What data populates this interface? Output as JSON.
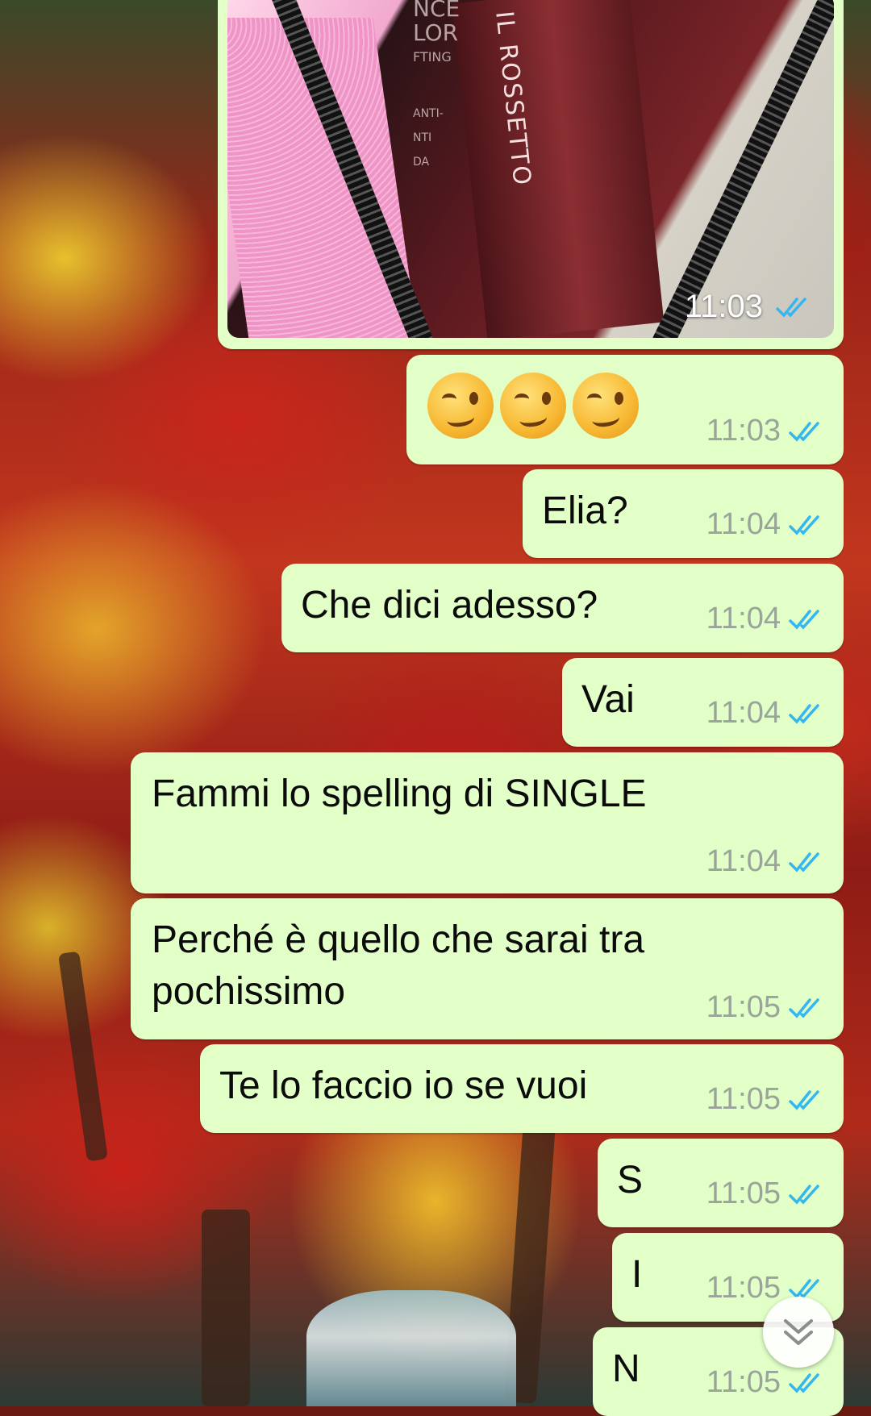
{
  "conversation": {
    "image_message": {
      "time": "11:03",
      "photo_text": {
        "brand_lines": [
          "NCE",
          "LOR",
          "FTING",
          "ANTI-",
          "NTI",
          "DA"
        ],
        "product": "IL ROSSETTO"
      }
    },
    "messages": [
      {
        "text": "",
        "emoji": [
          "winking-face",
          "winking-face",
          "winking-face"
        ],
        "time": "11:03"
      },
      {
        "text": "Elia?",
        "time": "11:04"
      },
      {
        "text": "Che dici adesso?",
        "time": "11:04"
      },
      {
        "text": "Vai",
        "time": "11:04"
      },
      {
        "text": "Fammi lo spelling di SINGLE",
        "time": "11:04"
      },
      {
        "text": "Perché è quello che sarai tra",
        "text_line2": "pochissimo",
        "time": "11:05"
      },
      {
        "text": "Te lo faccio io se vuoi",
        "time": "11:05"
      },
      {
        "text": "S",
        "time": "11:05"
      },
      {
        "text": "I",
        "time": "11:05"
      },
      {
        "text": "N",
        "time": "11:05"
      }
    ]
  },
  "status": {
    "read_icon": "double-check-icon",
    "read_color": "#34b7f1"
  },
  "scroll_button": {
    "icon": "double-chevron-down-icon"
  },
  "theme": {
    "outgoing_bubble": "#e1ffc7",
    "timestamp": "#9aa59a"
  }
}
